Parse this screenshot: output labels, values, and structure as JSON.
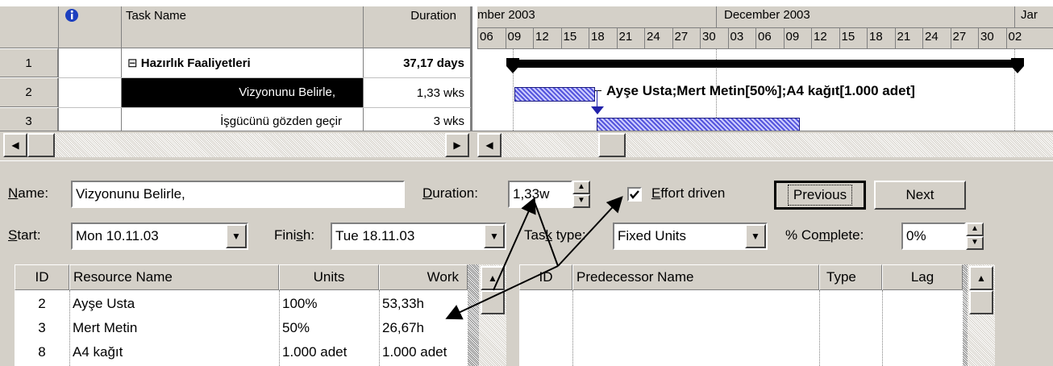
{
  "gantt_table": {
    "headers": {
      "info_icon": "info-icon",
      "task_name": "Task Name",
      "duration": "Duration"
    },
    "rows": [
      {
        "id": "1",
        "name": "Hazırlık Faaliyetleri",
        "duration": "37,17 days",
        "summary": true,
        "collapse_symbol": "⊟"
      },
      {
        "id": "2",
        "name": "Vizyonunu Belirle,",
        "duration": "1,33 wks",
        "selected": true
      },
      {
        "id": "3",
        "name": "İşgücünü gözden geçir",
        "duration": "3 wks"
      }
    ]
  },
  "timescale": {
    "months": [
      "mber 2003",
      "December 2003",
      "Jar"
    ],
    "days": [
      "06",
      "09",
      "12",
      "15",
      "18",
      "21",
      "24",
      "27",
      "30",
      "03",
      "06",
      "09",
      "12",
      "15",
      "18",
      "21",
      "24",
      "27",
      "30",
      "02"
    ]
  },
  "gantt_chart": {
    "task_label": "Ayşe Usta;Mert Metin[50%];A4 kağıt[1.000 adet]",
    "bar_color": "#3333cc",
    "summary_color": "#000000"
  },
  "form": {
    "name_label": "Name:",
    "name_value": "Vizyonunu Belirle,",
    "duration_label": "Duration:",
    "duration_value": "1,33w",
    "effort_driven_label": "Effort driven",
    "effort_driven_checked": true,
    "previous_label": "Previous",
    "next_label": "Next",
    "start_label": "Start:",
    "start_value": "Mon 10.11.03",
    "finish_label": "Finish:",
    "finish_value": "Tue 18.11.03",
    "task_type_label": "Task type:",
    "task_type_value": "Fixed Units",
    "complete_label": "% Complete:",
    "complete_value": "0%"
  },
  "resources": {
    "headers": [
      "ID",
      "Resource Name",
      "Units",
      "Work"
    ],
    "rows": [
      {
        "id": "2",
        "name": "Ayşe Usta",
        "units": "100%",
        "work": "53,33h"
      },
      {
        "id": "3",
        "name": "Mert Metin",
        "units": "50%",
        "work": "26,67h"
      },
      {
        "id": "8",
        "name": "A4 kağıt",
        "units": "1.000 adet",
        "work": "1.000 adet"
      }
    ]
  },
  "predecessors": {
    "headers": [
      "ID",
      "Predecessor Name",
      "Type",
      "Lag"
    ]
  }
}
